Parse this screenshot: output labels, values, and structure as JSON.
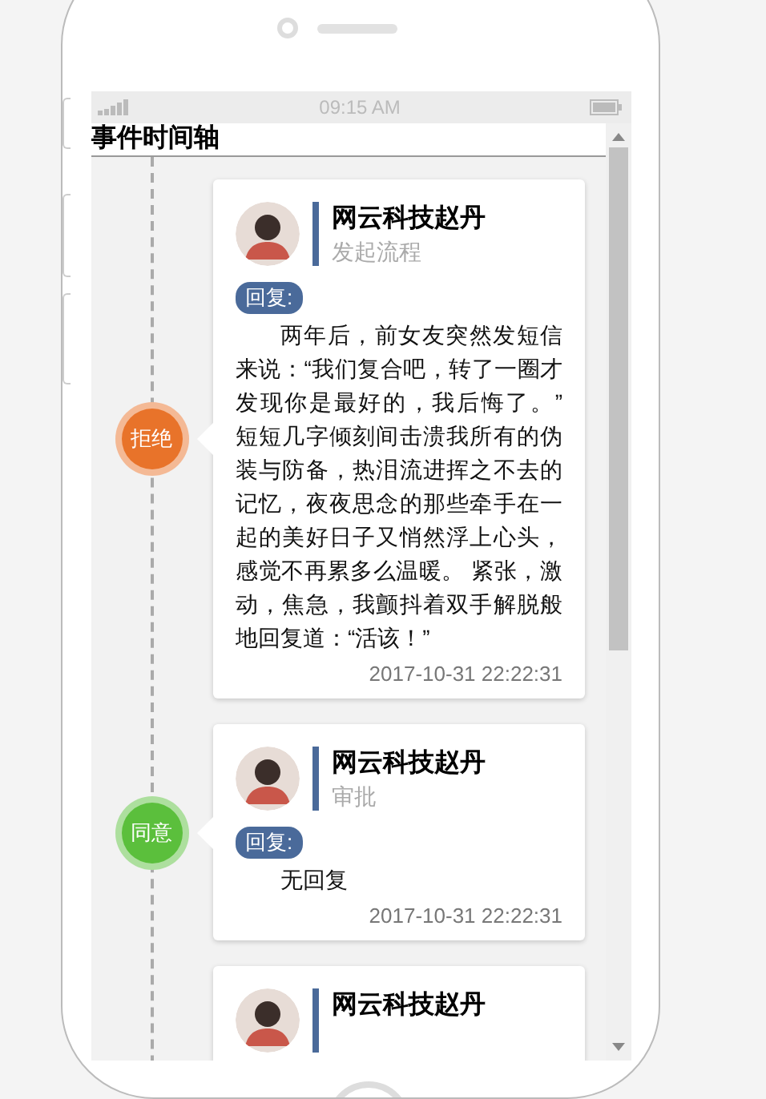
{
  "status_bar": {
    "time": "09:15 AM"
  },
  "title": "事件时间轴",
  "events": [
    {
      "status": "拒绝",
      "color": "#e8732a",
      "name": "网云科技赵丹",
      "step": "发起流程",
      "reply_label": "回复:",
      "reply": "两年后，前女友突然发短信来说：“我们复合吧，转了一圈才发现你是最好的，我后悔了。” 短短几字倾刻间击溃我所有的伪装与防备，热泪流进挥之不去的记忆，夜夜思念的那些牵手在一起的美好日子又悄然浮上心头，感觉不再累多么温暖。 紧张，激动，焦急，我颤抖着双手解脱般地回复道：“活该！”",
      "time": "2017-10-31 22:22:31"
    },
    {
      "status": "同意",
      "color": "#5bbf3c",
      "name": "网云科技赵丹",
      "step": "审批",
      "reply_label": "回复:",
      "reply": "无回复",
      "time": "2017-10-31 22:22:31"
    },
    {
      "name": "网云科技赵丹"
    }
  ]
}
